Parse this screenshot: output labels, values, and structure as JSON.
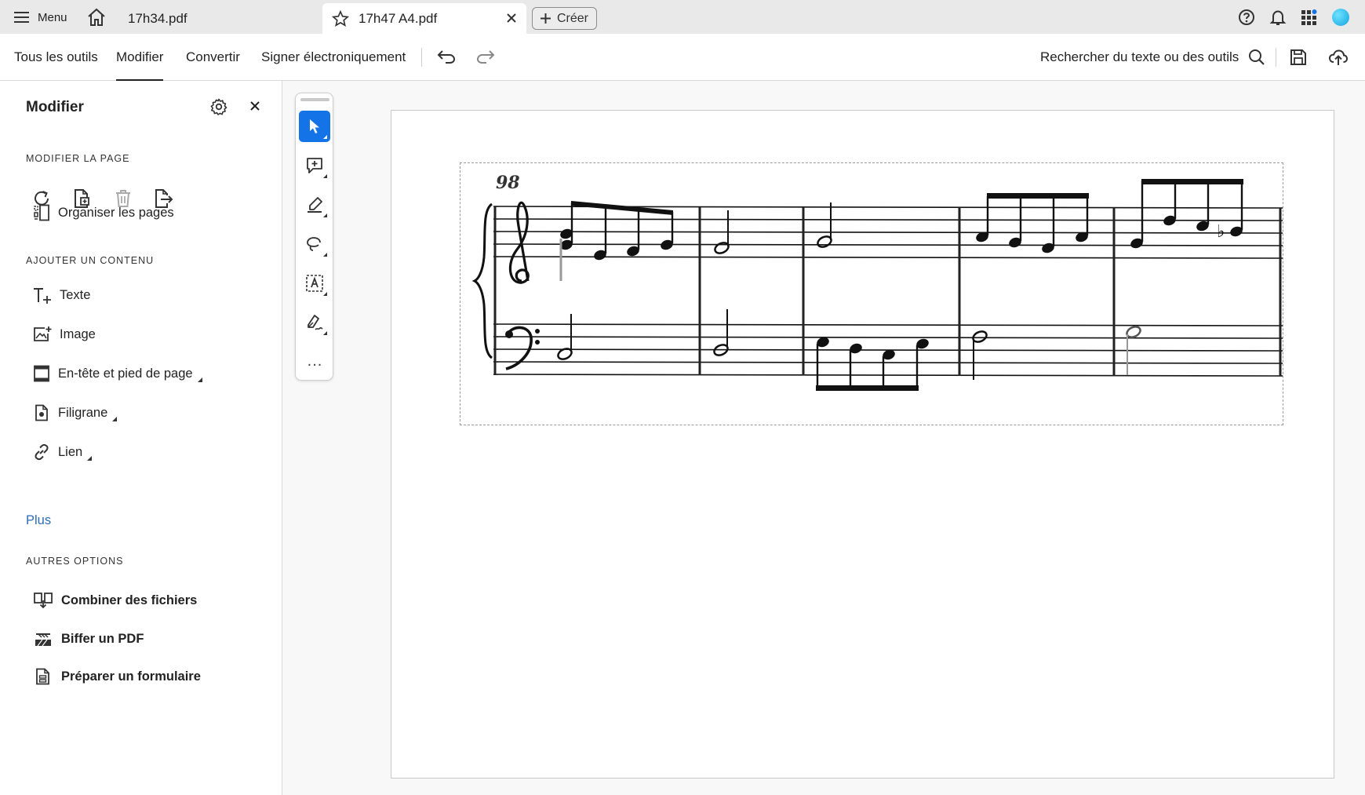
{
  "tabbar": {
    "menu_label": "Menu",
    "tabs": [
      {
        "label": "17h34.pdf",
        "active": false
      },
      {
        "label": "17h47 A4.pdf",
        "active": true
      }
    ],
    "create_label": "Créer",
    "icons": [
      "menu-icon",
      "home-icon",
      "star-icon",
      "close-icon",
      "plus-icon",
      "help-icon",
      "bell-icon",
      "apps-grid-icon",
      "avatar"
    ]
  },
  "toolbar": {
    "tabs": [
      {
        "label": "Tous les outils",
        "active": false
      },
      {
        "label": "Modifier",
        "active": true
      },
      {
        "label": "Convertir",
        "active": false
      },
      {
        "label": "Signer électroniquement",
        "active": false
      }
    ],
    "search_label": "Rechercher du texte ou des outils",
    "icons": [
      "undo-icon",
      "redo-icon",
      "search-icon",
      "save-icon",
      "cloud-upload-icon"
    ]
  },
  "sidebar": {
    "title": "Modifier",
    "sections": {
      "modify_page": {
        "label": "MODIFIER LA PAGE",
        "tools": [
          "rotate-icon",
          "insert-page-icon",
          "delete-icon",
          "extract-page-icon"
        ],
        "organize_label": "Organiser les pages"
      },
      "add_content": {
        "label": "AJOUTER UN CONTENU",
        "items": [
          "Texte",
          "Image",
          "En-tête et pied de page",
          "Filigrane",
          "Lien"
        ],
        "more_label": "Plus"
      },
      "other_options": {
        "label": "AUTRES OPTIONS",
        "items": [
          "Combiner des fichiers",
          "Biffer un PDF",
          "Préparer un formulaire"
        ]
      }
    }
  },
  "floating_tools": [
    "select-cursor-icon",
    "add-comment-icon",
    "highlight-pen-icon",
    "lasso-draw-icon",
    "text-box-icon",
    "signature-pen-icon"
  ],
  "more_label": "...",
  "document": {
    "measure_number": "98",
    "colors": {
      "accent": "#1473e6",
      "link": "#2c6db6"
    }
  }
}
